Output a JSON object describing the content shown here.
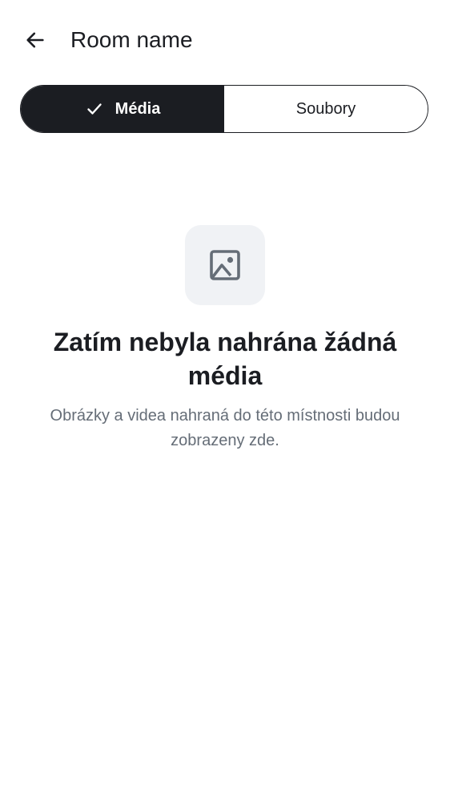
{
  "header": {
    "back_icon": "arrow-left-icon",
    "title": "Room name"
  },
  "tabs": [
    {
      "label": "Média",
      "selected": true,
      "icon": "check-icon"
    },
    {
      "label": "Soubory",
      "selected": false
    }
  ],
  "empty_state": {
    "icon": "image-icon",
    "title": "Zatím nebyla nahrána žádná média",
    "description": "Obrázky a videa nahraná do této místnosti budou zobrazeny zde."
  },
  "colors": {
    "primary": "#1b1d22",
    "on_primary": "#ffffff",
    "icon_box_background": "#f0f2f5",
    "icon_color": "#656d77",
    "secondary_text": "#656d77"
  }
}
